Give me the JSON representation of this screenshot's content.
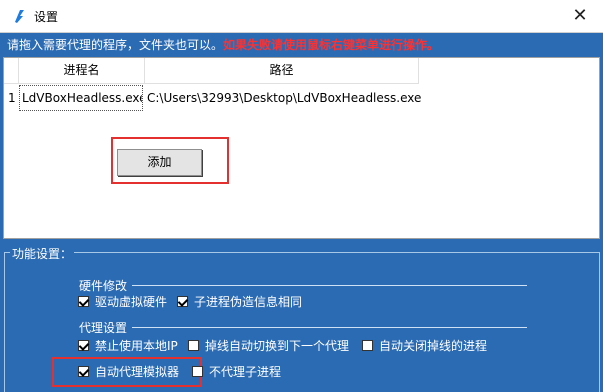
{
  "window": {
    "title": "设置",
    "close_glyph": "✕"
  },
  "hint": {
    "text": "请拖入需要代理的程序，文件夹也可以。",
    "warning": "如果失败请使用鼠标右键菜单进行操作。"
  },
  "table": {
    "columns": [
      "进程名",
      "路径"
    ],
    "rows": [
      {
        "index": "1",
        "name": "LdVBoxHeadless.exe",
        "path": "C:\\Users\\32993\\Desktop\\LdVBoxHeadless.exe"
      }
    ]
  },
  "add_button": "添加",
  "functions": {
    "legend": "功能设置：",
    "hardware": {
      "label": "硬件修改",
      "options": [
        {
          "label": "驱动虚拟硬件",
          "checked": true
        },
        {
          "label": "子进程伪造信息相同",
          "checked": true
        }
      ]
    },
    "proxy": {
      "label": "代理设置",
      "options": [
        {
          "label": "禁止使用本地IP",
          "checked": true
        },
        {
          "label": "掉线自动切换到下一个代理",
          "checked": false
        },
        {
          "label": "自动关闭掉线的进程",
          "checked": false
        },
        {
          "label": "自动代理模拟器",
          "checked": true
        },
        {
          "label": "不代理子进程",
          "checked": false
        }
      ]
    }
  },
  "colors": {
    "background": "#2b6bb3",
    "warning": "#ff3030",
    "highlight_box": "#e53030"
  }
}
